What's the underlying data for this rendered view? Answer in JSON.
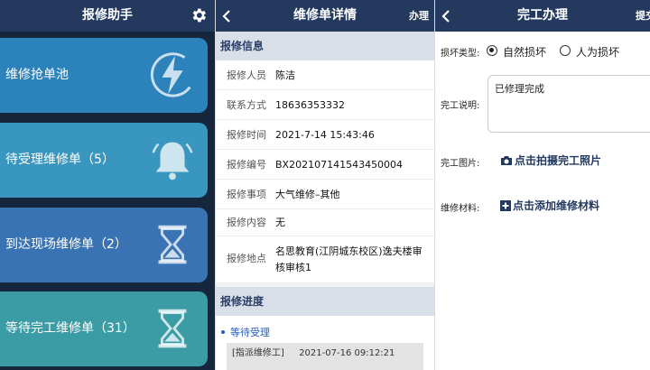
{
  "left": {
    "title": "报修助手",
    "cards": [
      {
        "label": "维修抢单池",
        "icon": "lightning-icon",
        "color": "#2c82bb"
      },
      {
        "label": "待受理维修单（5）",
        "icon": "bell-icon",
        "color": "#3997bf"
      },
      {
        "label": "到达现场维修单（2）",
        "icon": "hourglass-icon",
        "color": "#3a73b4"
      },
      {
        "label": "等待完工维修单（31）",
        "icon": "hourglass-icon",
        "color": "#3b9ca6"
      }
    ]
  },
  "detail": {
    "title": "维修单详情",
    "action": "办理",
    "info_header": "报修信息",
    "fields": [
      {
        "key": "报修人员",
        "value": "陈洁"
      },
      {
        "key": "联系方式",
        "value": "18636353332"
      },
      {
        "key": "报修时间",
        "value": "2021-7-14 15:43:46"
      },
      {
        "key": "报修编号",
        "value": "BX202107141543450004"
      },
      {
        "key": "报修事项",
        "value": "大气维修–其他"
      },
      {
        "key": "报修内容",
        "value": "无"
      },
      {
        "key": "报修地点",
        "value": "名思教育(江阴城东校区)逸夫楼审核审核1"
      }
    ],
    "progress_header": "报修进度",
    "progress_status": "等待受理",
    "progress_log_action": "[指派维修工]",
    "progress_log_time": "2021-07-16 09:12:21"
  },
  "complete": {
    "title": "完工办理",
    "action": "提交",
    "damage_label": "损坏类型:",
    "option_natural": "自然损坏",
    "option_human": "人为损坏",
    "selected": "自然损坏",
    "desc_label": "完工说明:",
    "desc_value": "已修理完成",
    "photo_label": "完工图片:",
    "photo_button": "点击拍摄完工照片",
    "material_label": "维修材料:",
    "material_button": "点击添加维修材料"
  },
  "colors": {
    "header": "#23395e",
    "left_bg": "#15263d",
    "accent": "#2a5cb4"
  }
}
